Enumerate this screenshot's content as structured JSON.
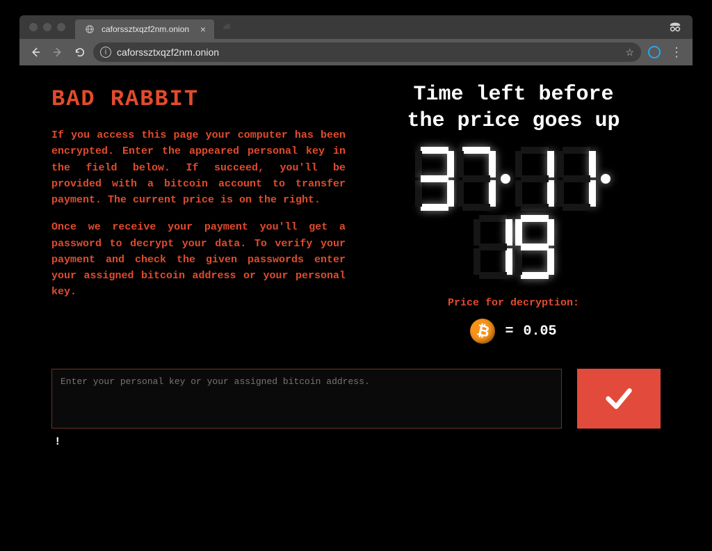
{
  "browser": {
    "tab_title": "caforssztxqzf2nm.onion",
    "url": "caforssztxqzf2nm.onion"
  },
  "page": {
    "title": "BAD RABBIT",
    "para1": "If you access this page your computer has been encrypted. Enter the appeared personal key in the field below. If succeed, you'll be provided with a bitcoin account to transfer payment. The current price is on the right.",
    "para2": "Once we receive your payment you'll get a password to decrypt your data. To verify your payment and check the given passwords enter your assigned bitcoin address or your personal key.",
    "timer_heading_l1": "Time left before",
    "timer_heading_l2": "the price goes up",
    "timer": {
      "hours": "37",
      "minutes": "11",
      "seconds": "19"
    },
    "price_label": "Price for decryption:",
    "price_equals": "=",
    "price_value": "0.05",
    "input_placeholder": "Enter your personal key or your assigned bitcoin address.",
    "notice": "!"
  }
}
